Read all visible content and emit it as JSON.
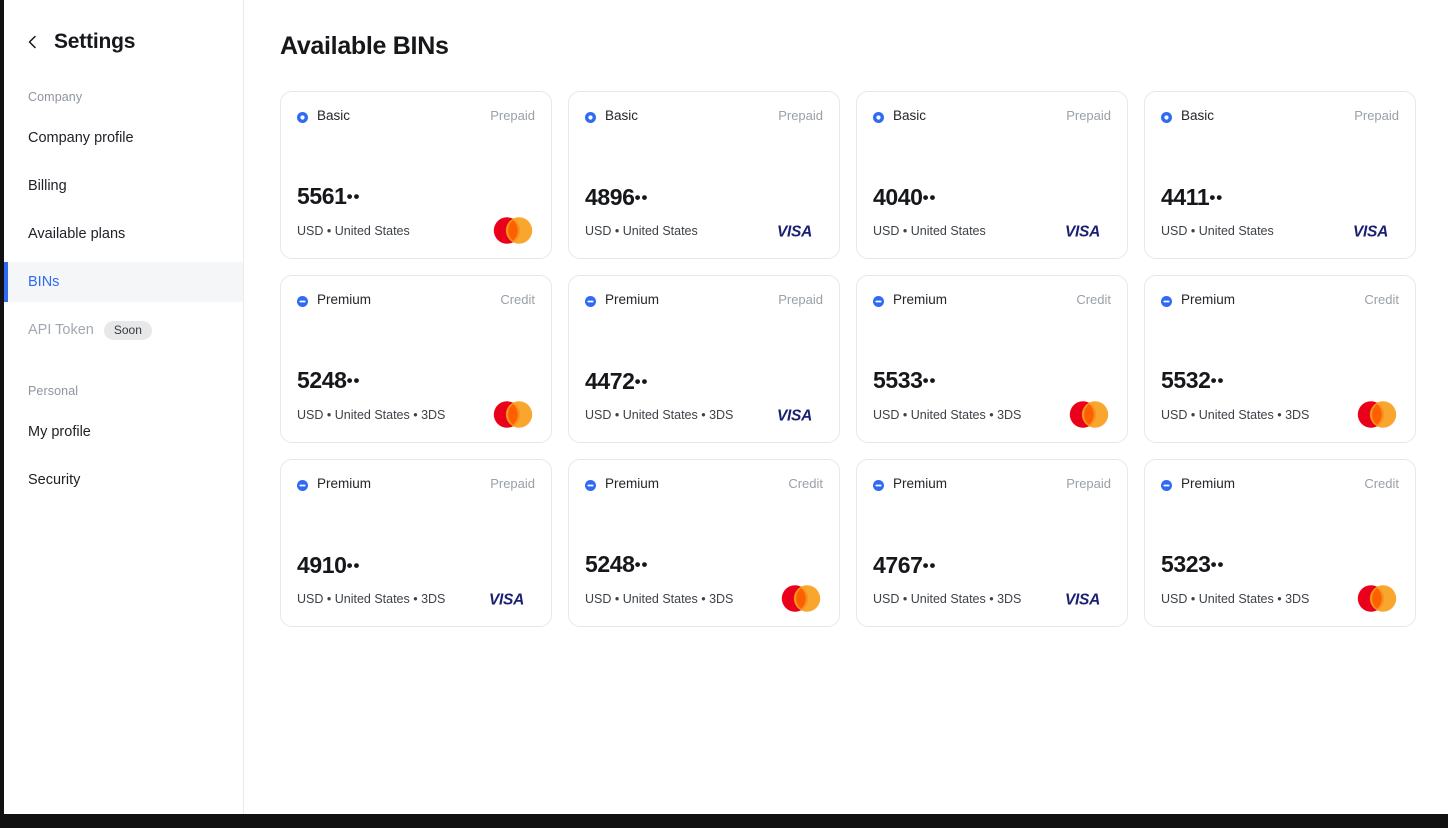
{
  "window": {
    "frame_color": "#111111"
  },
  "sidebar": {
    "back_icon": "chevron-left-icon",
    "title": "Settings",
    "groups": [
      {
        "label": "Company",
        "items": [
          {
            "label": "Company profile",
            "active": false,
            "disabled": false,
            "badge": null
          },
          {
            "label": "Billing",
            "active": false,
            "disabled": false,
            "badge": null
          },
          {
            "label": "Available plans",
            "active": false,
            "disabled": false,
            "badge": null
          },
          {
            "label": "BINs",
            "active": true,
            "disabled": false,
            "badge": null
          },
          {
            "label": "API Token",
            "active": false,
            "disabled": true,
            "badge": "Soon"
          }
        ]
      },
      {
        "label": "Personal",
        "items": [
          {
            "label": "My profile",
            "active": false,
            "disabled": false,
            "badge": null
          },
          {
            "label": "Security",
            "active": false,
            "disabled": false,
            "badge": null
          }
        ]
      }
    ]
  },
  "main": {
    "page_title": "Available BINs"
  },
  "colors": {
    "accent_blue": "#2f6bf2",
    "visa_blue": "#1a1f71",
    "mastercard_red": "#eb001b",
    "mastercard_orange": "#f79e1b",
    "card_border": "#e6e8eb",
    "muted_text": "#9aa0a8",
    "active_bg": "#f4f6f8",
    "soon_badge_bg": "#e7e8ea"
  },
  "cards": [
    {
      "tier": "Basic",
      "tier_icon": "circle-ring-icon",
      "funding": "Prepaid",
      "bin": "5561",
      "mask": "••",
      "meta": "USD • United States",
      "brand": "mastercard",
      "brand_label": "Mastercard"
    },
    {
      "tier": "Basic",
      "tier_icon": "circle-ring-icon",
      "funding": "Prepaid",
      "bin": "4896",
      "mask": "••",
      "meta": "USD • United States",
      "brand": "visa",
      "brand_label": "VISA"
    },
    {
      "tier": "Basic",
      "tier_icon": "circle-ring-icon",
      "funding": "Prepaid",
      "bin": "4040",
      "mask": "••",
      "meta": "USD • United States",
      "brand": "visa",
      "brand_label": "VISA"
    },
    {
      "tier": "Basic",
      "tier_icon": "circle-ring-icon",
      "funding": "Prepaid",
      "bin": "4411",
      "mask": "••",
      "meta": "USD • United States",
      "brand": "visa",
      "brand_label": "VISA"
    },
    {
      "tier": "Premium",
      "tier_icon": "circle-minus-icon",
      "funding": "Credit",
      "bin": "5248",
      "mask": "••",
      "meta": "USD • United States • 3DS",
      "brand": "mastercard",
      "brand_label": "Mastercard"
    },
    {
      "tier": "Premium",
      "tier_icon": "circle-minus-icon",
      "funding": "Prepaid",
      "bin": "4472",
      "mask": "••",
      "meta": "USD • United States • 3DS",
      "brand": "visa",
      "brand_label": "VISA"
    },
    {
      "tier": "Premium",
      "tier_icon": "circle-minus-icon",
      "funding": "Credit",
      "bin": "5533",
      "mask": "••",
      "meta": "USD • United States • 3DS",
      "brand": "mastercard",
      "brand_label": "Mastercard"
    },
    {
      "tier": "Premium",
      "tier_icon": "circle-minus-icon",
      "funding": "Credit",
      "bin": "5532",
      "mask": "••",
      "meta": "USD • United States • 3DS",
      "brand": "mastercard",
      "brand_label": "Mastercard"
    },
    {
      "tier": "Premium",
      "tier_icon": "circle-minus-icon",
      "funding": "Prepaid",
      "bin": "4910",
      "mask": "••",
      "meta": "USD • United States • 3DS",
      "brand": "visa",
      "brand_label": "VISA"
    },
    {
      "tier": "Premium",
      "tier_icon": "circle-minus-icon",
      "funding": "Credit",
      "bin": "5248",
      "mask": "••",
      "meta": "USD • United States • 3DS",
      "brand": "mastercard",
      "brand_label": "Mastercard"
    },
    {
      "tier": "Premium",
      "tier_icon": "circle-minus-icon",
      "funding": "Prepaid",
      "bin": "4767",
      "mask": "••",
      "meta": "USD • United States • 3DS",
      "brand": "visa",
      "brand_label": "VISA"
    },
    {
      "tier": "Premium",
      "tier_icon": "circle-minus-icon",
      "funding": "Credit",
      "bin": "5323",
      "mask": "••",
      "meta": "USD • United States • 3DS",
      "brand": "mastercard",
      "brand_label": "Mastercard"
    }
  ]
}
